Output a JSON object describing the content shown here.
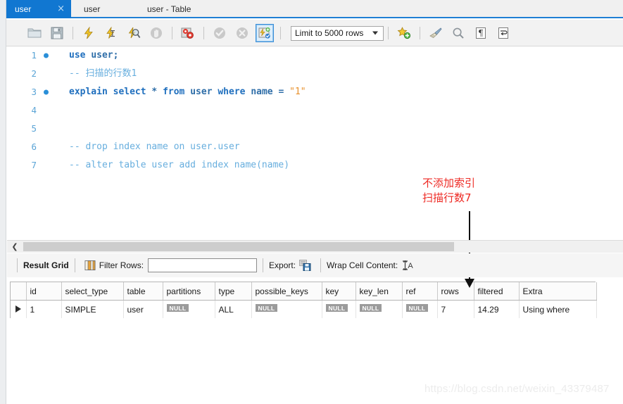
{
  "window": {
    "tabs": [
      {
        "label": "user",
        "active": true,
        "close_glyph": "×"
      },
      {
        "label": "user",
        "active": false
      },
      {
        "label": "user - Table",
        "active": false
      }
    ]
  },
  "toolbar": {
    "buttons": [
      {
        "name": "open-sql-script-icon",
        "title": "Open a SQL script file"
      },
      {
        "name": "save-script-icon",
        "title": "Save script to file"
      },
      {
        "name": "execute-statement-icon",
        "title": "Execute the selected portion"
      },
      {
        "name": "execute-current-statement-icon",
        "title": "Execute current statement"
      },
      {
        "name": "explain-statement-icon",
        "title": "Execute explain for statement"
      },
      {
        "name": "stop-statement-icon",
        "title": "Stop the statement"
      },
      {
        "name": "toggle-stop-on-error-icon",
        "title": "Toggle stop on error"
      },
      {
        "name": "commit-icon",
        "title": "Commit"
      },
      {
        "name": "rollback-icon",
        "title": "Rollback"
      },
      {
        "name": "toggle-autocommit-icon",
        "title": "Toggle autocommit mode",
        "selected": true
      },
      {
        "name": "beautify-sql-icon",
        "title": "Beautify / reformat SQL"
      },
      {
        "name": "find-icon",
        "title": "Find"
      },
      {
        "name": "toggle-invisible-chars-icon",
        "title": "Show invisible characters"
      },
      {
        "name": "wrap-lines-icon",
        "title": "Toggle wrapping of long lines"
      }
    ],
    "limit_label": "Limit to 5000 rows"
  },
  "editor": {
    "lines": [
      {
        "num": "1",
        "breakpoint": true,
        "tokens": [
          {
            "t": "use",
            "c": "kw"
          },
          {
            "t": " ",
            "c": ""
          },
          {
            "t": "user",
            "c": "idn"
          },
          {
            "t": ";",
            "c": "op"
          }
        ]
      },
      {
        "num": "2",
        "breakpoint": false,
        "tokens": [
          {
            "t": "-- 扫描的行数1",
            "c": "cmt"
          }
        ]
      },
      {
        "num": "3",
        "breakpoint": true,
        "tokens": [
          {
            "t": "explain",
            "c": "kw"
          },
          {
            "t": " ",
            "c": ""
          },
          {
            "t": "select",
            "c": "kw"
          },
          {
            "t": " ",
            "c": ""
          },
          {
            "t": "*",
            "c": "op"
          },
          {
            "t": " ",
            "c": ""
          },
          {
            "t": "from",
            "c": "kw"
          },
          {
            "t": " ",
            "c": ""
          },
          {
            "t": "user",
            "c": "idn"
          },
          {
            "t": " ",
            "c": ""
          },
          {
            "t": "where",
            "c": "kw"
          },
          {
            "t": " ",
            "c": ""
          },
          {
            "t": "name",
            "c": "idn"
          },
          {
            "t": " ",
            "c": ""
          },
          {
            "t": "=",
            "c": "op"
          },
          {
            "t": " ",
            "c": ""
          },
          {
            "t": "\"1\"",
            "c": "str"
          }
        ]
      },
      {
        "num": "4",
        "breakpoint": false,
        "tokens": []
      },
      {
        "num": "5",
        "breakpoint": false,
        "tokens": []
      },
      {
        "num": "6",
        "breakpoint": false,
        "tokens": [
          {
            "t": "-- drop index name on user.user",
            "c": "cmt"
          }
        ]
      },
      {
        "num": "7",
        "breakpoint": false,
        "tokens": [
          {
            "t": "-- alter table user add index name(name)",
            "c": "cmt"
          }
        ]
      }
    ]
  },
  "annotation": {
    "text": "不添加索引\n扫描行数7",
    "color": "#ee2a24"
  },
  "result_panel": {
    "result_grid_label": "Result Grid",
    "filter_rows_label": "Filter Rows:",
    "filter_rows_value": "",
    "filter_rows_placeholder": "",
    "export_label": "Export:",
    "wrap_cell_label": "Wrap Cell Content:",
    "wrap_cell_glyph": "⩶A"
  },
  "grid": {
    "columns": [
      "id",
      "select_type",
      "table",
      "partitions",
      "type",
      "possible_keys",
      "key",
      "key_len",
      "ref",
      "rows",
      "filtered",
      "Extra"
    ],
    "rows": [
      {
        "marker": true,
        "cells": [
          {
            "v": "1"
          },
          {
            "v": "SIMPLE"
          },
          {
            "v": "user"
          },
          {
            "v": "NULL",
            "null": true
          },
          {
            "v": "ALL"
          },
          {
            "v": "NULL",
            "null": true
          },
          {
            "v": "NULL",
            "null": true
          },
          {
            "v": "NULL",
            "null": true
          },
          {
            "v": "NULL",
            "null": true
          },
          {
            "v": "7",
            "selected": true
          },
          {
            "v": "14.29"
          },
          {
            "v": "Using where"
          }
        ]
      }
    ]
  },
  "watermark": {
    "text": "https://blog.csdn.net/weixin_43379487"
  }
}
